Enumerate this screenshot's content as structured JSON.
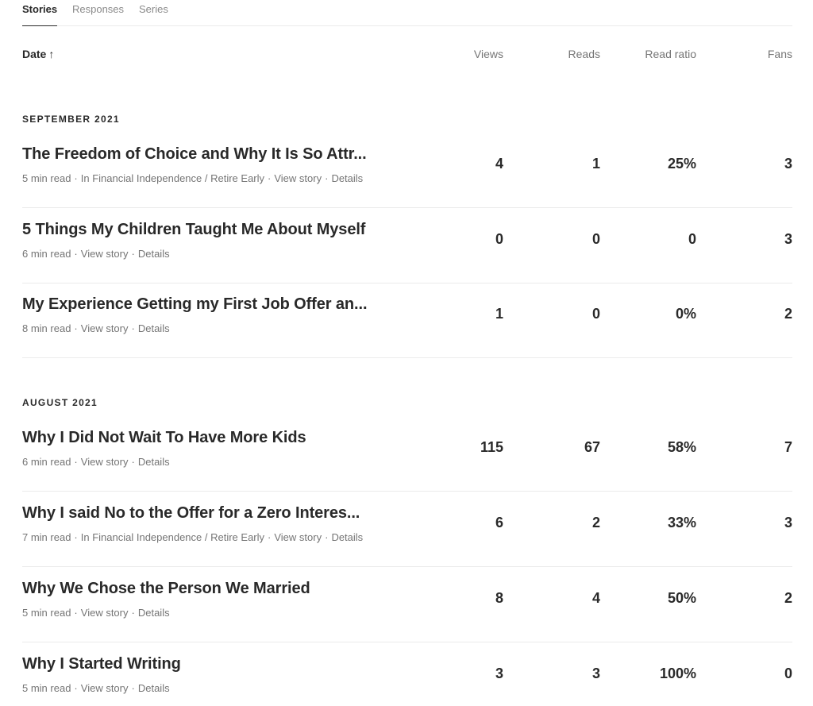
{
  "tabs": [
    {
      "label": "Stories"
    },
    {
      "label": "Responses"
    },
    {
      "label": "Series"
    }
  ],
  "header": {
    "date": "Date",
    "date_sort_icon": "arrow-up-icon",
    "views": "Views",
    "reads": "Reads",
    "read_ratio": "Read ratio",
    "fans": "Fans"
  },
  "months": [
    {
      "label": "SEPTEMBER 2021",
      "stories": [
        {
          "title": "The Freedom of Choice and Why It Is So Attr...",
          "read_time": "5 min read",
          "publication": "In Financial Independence / Retire Early",
          "view_story": "View story",
          "details": "Details",
          "views": "4",
          "reads": "1",
          "ratio": "25%",
          "fans": "3"
        },
        {
          "title": "5 Things My Children Taught Me About Myself",
          "read_time": "6 min read",
          "view_story": "View story",
          "details": "Details",
          "views": "0",
          "reads": "0",
          "ratio": "0",
          "fans": "3"
        },
        {
          "title": "My Experience Getting my First Job Offer an...",
          "read_time": "8 min read",
          "view_story": "View story",
          "details": "Details",
          "views": "1",
          "reads": "0",
          "ratio": "0%",
          "fans": "2"
        }
      ]
    },
    {
      "label": "AUGUST 2021",
      "stories": [
        {
          "title": "Why I Did Not Wait To Have More Kids",
          "read_time": "6 min read",
          "view_story": "View story",
          "details": "Details",
          "views": "115",
          "reads": "67",
          "ratio": "58%",
          "fans": "7"
        },
        {
          "title": "Why I said No to the Offer for a Zero Interes...",
          "read_time": "7 min read",
          "publication": "In Financial Independence / Retire Early",
          "view_story": "View story",
          "details": "Details",
          "views": "6",
          "reads": "2",
          "ratio": "33%",
          "fans": "3"
        },
        {
          "title": "Why We Chose the Person We Married",
          "read_time": "5 min read",
          "view_story": "View story",
          "details": "Details",
          "views": "8",
          "reads": "4",
          "ratio": "50%",
          "fans": "2"
        },
        {
          "title": "Why I Started Writing",
          "read_time": "5 min read",
          "view_story": "View story",
          "details": "Details",
          "views": "3",
          "reads": "3",
          "ratio": "100%",
          "fans": "0"
        }
      ]
    }
  ],
  "separator": "·"
}
